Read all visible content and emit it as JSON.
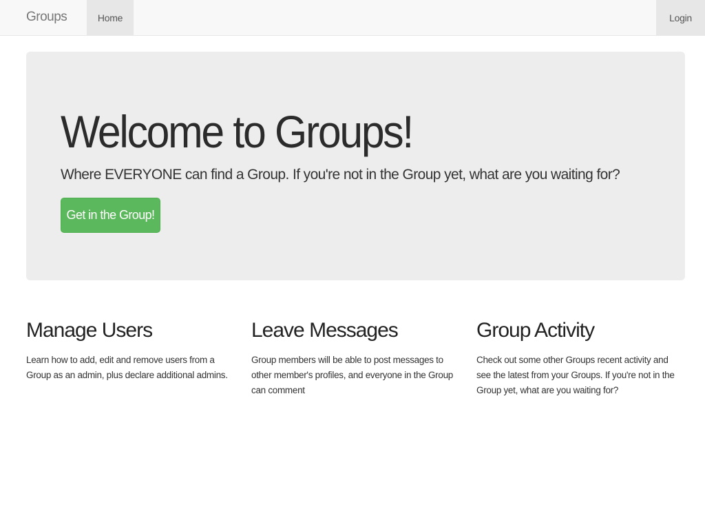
{
  "navbar": {
    "brand": "Groups",
    "home": "Home",
    "login": "Login"
  },
  "hero": {
    "title": "Welcome to Groups!",
    "subtitle": "Where EVERYONE can find a Group. If you're not in the Group yet, what are you waiting for?",
    "button": "Get in the Group!",
    "button_color": "#5cb85c"
  },
  "features": [
    {
      "title": "Manage Users",
      "text": "Learn how to add, edit and remove users from a Group as an admin, plus declare additional admins."
    },
    {
      "title": "Leave Messages",
      "text": "Group members will be able to post messages to other member's profiles, and everyone in the Group can comment"
    },
    {
      "title": "Group Activity",
      "text": "Check out some other Groups recent activity and see the latest from your Groups. If you're not in the Group yet, what are you waiting for?"
    }
  ]
}
